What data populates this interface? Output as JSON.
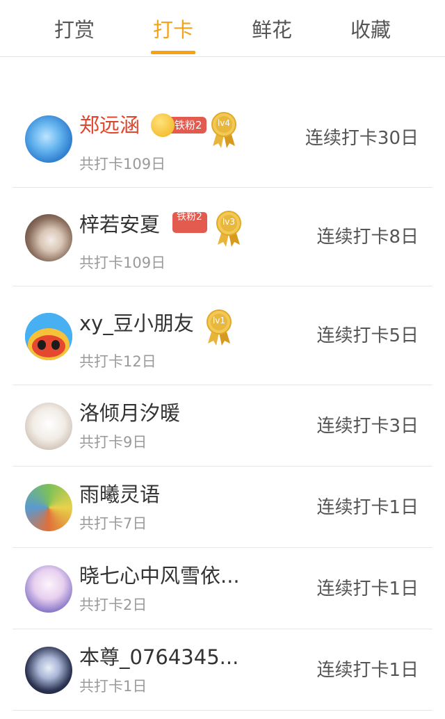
{
  "tabs": [
    {
      "label": "打赏",
      "active": false
    },
    {
      "label": "打卡",
      "active": true
    },
    {
      "label": "鲜花",
      "active": false
    },
    {
      "label": "收藏",
      "active": false
    }
  ],
  "accent_color": "#f5a214",
  "users": [
    {
      "name": "郑远涵",
      "name_color": "#e0452d",
      "fan_badge": "铁粉2",
      "level": "lv4",
      "total": "共打卡109日",
      "streak": "连续打卡30日"
    },
    {
      "name": "梓若安夏",
      "fan_badge": "铁粉2",
      "level": "lv3",
      "total": "共打卡109日",
      "streak": "连续打卡8日"
    },
    {
      "name": "xy_豆小朋友",
      "level": "lv1",
      "total": "共打卡12日",
      "streak": "连续打卡5日"
    },
    {
      "name": "洛倾月汐暖",
      "total": "共打卡9日",
      "streak": "连续打卡3日"
    },
    {
      "name": "雨曦灵语",
      "total": "共打卡7日",
      "streak": "连续打卡1日"
    },
    {
      "name": "晓七心中风雪依...",
      "total": "共打卡2日",
      "streak": "连续打卡1日"
    },
    {
      "name": "本尊_0764345...",
      "total": "共打卡1日",
      "streak": "连续打卡1日"
    }
  ]
}
